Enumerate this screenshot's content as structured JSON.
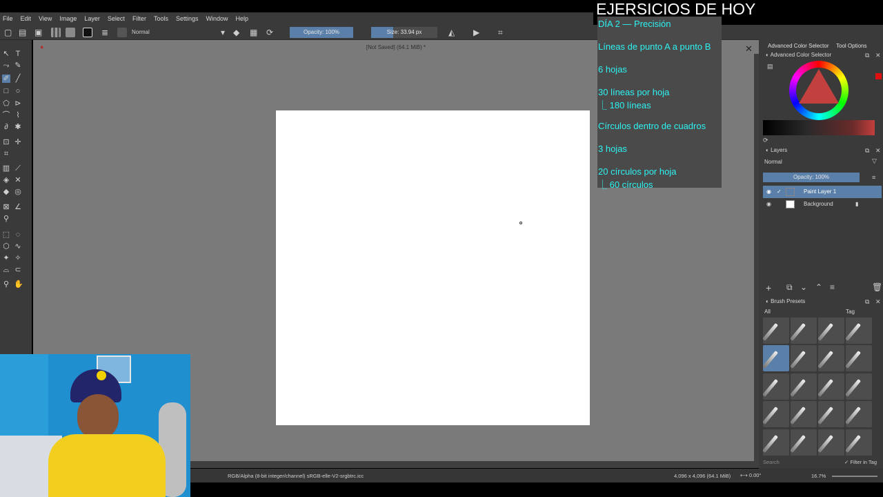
{
  "overlay": {
    "title": "EJERSICIOS DE HOY",
    "lines": [
      "DÍA 2 — Precisión",
      "Líneas de punto A a punto B",
      "6 hojas",
      "30 líneas por hoja",
      "⎿ 180 líneas",
      "Círculos dentro de cuadros",
      "3 hojas",
      "20 círculos por hoja",
      "⎿ 60 círculos"
    ]
  },
  "menu": [
    "File",
    "Edit",
    "View",
    "Image",
    "Layer",
    "Select",
    "Filter",
    "Tools",
    "Settings",
    "Window",
    "Help"
  ],
  "toolbar": {
    "blend_mode": "Normal",
    "opacity_label": "Opacity: 100%",
    "size_label": "Size: 33.94 px"
  },
  "document": {
    "title": "[Not Saved]  (64.1 MiB) *",
    "close_glyph": "✕"
  },
  "status": {
    "color_info": "RGB/Alpha (8-bit integer/channel)  sRGB-elle-V2-srgbtrc.icc",
    "dimensions": "4,096 x 4,096 (64.1 MiB)",
    "rotation": "⟷ 0.00°",
    "zoom": "16.7%"
  },
  "dock": {
    "tab_color": "Advanced Color Selector",
    "tab_tool": "Tool Options",
    "color_header": "Advanced Color Selector",
    "layers_header": "Layers",
    "layers_blend": "Normal",
    "layers_opacity": "Opacity: 100%",
    "layers": [
      {
        "name": "Paint Layer 1",
        "selected": true
      },
      {
        "name": "Background",
        "selected": false
      }
    ],
    "brush_header": "Brush Presets",
    "brush_filter": "All",
    "brush_tag": "Tag",
    "brush_search": "Search",
    "filter_in_tag": "✓ Filter in Tag"
  },
  "colors": {
    "accent": "#5a7fa8",
    "overlay_text": "#2ef2f2",
    "canvas_bg": "#7a7a7a",
    "panel_bg": "#3a3a3a"
  }
}
